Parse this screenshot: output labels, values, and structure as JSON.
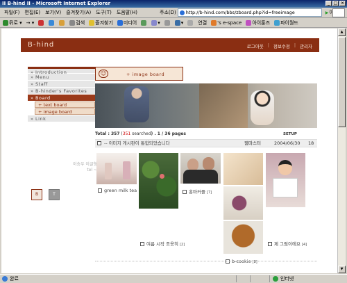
{
  "window": {
    "title": "II B-hind II - Microsoft Internet Explorer"
  },
  "menu": [
    "파일(F)",
    "편집(E)",
    "보기(V)",
    "즐겨찾기(A)",
    "도구(T)",
    "도움말(H)"
  ],
  "address": {
    "label": "주소(D)",
    "url": "http://b-hind.com/bbs/zboard.php?id=freeimage",
    "go": "이동"
  },
  "toolbar": [
    "뒤로",
    "검색",
    "즐겨찾기",
    "미디어",
    "연결",
    "'s e-space",
    "아이툰즈",
    "파이월드"
  ],
  "site": {
    "logo": "B-hind",
    "links": [
      "로그아웃",
      "정보수정",
      "관리자"
    ]
  },
  "sidebar": {
    "items": [
      "Introduction",
      "Menu",
      "Staff",
      "B-hinder's Favorites",
      "Board"
    ],
    "subitems": [
      "text board",
      "image board"
    ],
    "last": "Link",
    "contact_1": "이승우 이글형 ",
    "contact_2": "tel ~  ",
    "buttons": [
      "B",
      "T"
    ]
  },
  "board": {
    "tab_label": "image board",
    "total_label": "Total : ",
    "total": "357",
    "searched": "351",
    "searched_suffix": " searched",
    "page_info": ") . 1 / 36 pages",
    "setup": "SETUP",
    "notice": {
      "subject": "-- 이미지 게시판이 통합되었습니다",
      "author": "웹마스터",
      "date": "2004/06/30",
      "hits": "18"
    },
    "posts": [
      {
        "caption": "green milk tea",
        "count": ""
      },
      {
        "caption": "여름 시작 조용히 ",
        "count": "[2]"
      },
      {
        "caption": "홍마커플 ",
        "count": "[7]"
      },
      {
        "caption": "b-cookie ",
        "count": "[8]"
      },
      {
        "caption": "제 그림이에요 ",
        "count": "[4]"
      }
    ]
  },
  "status": {
    "text": "완료",
    "zone": "인터넷"
  }
}
